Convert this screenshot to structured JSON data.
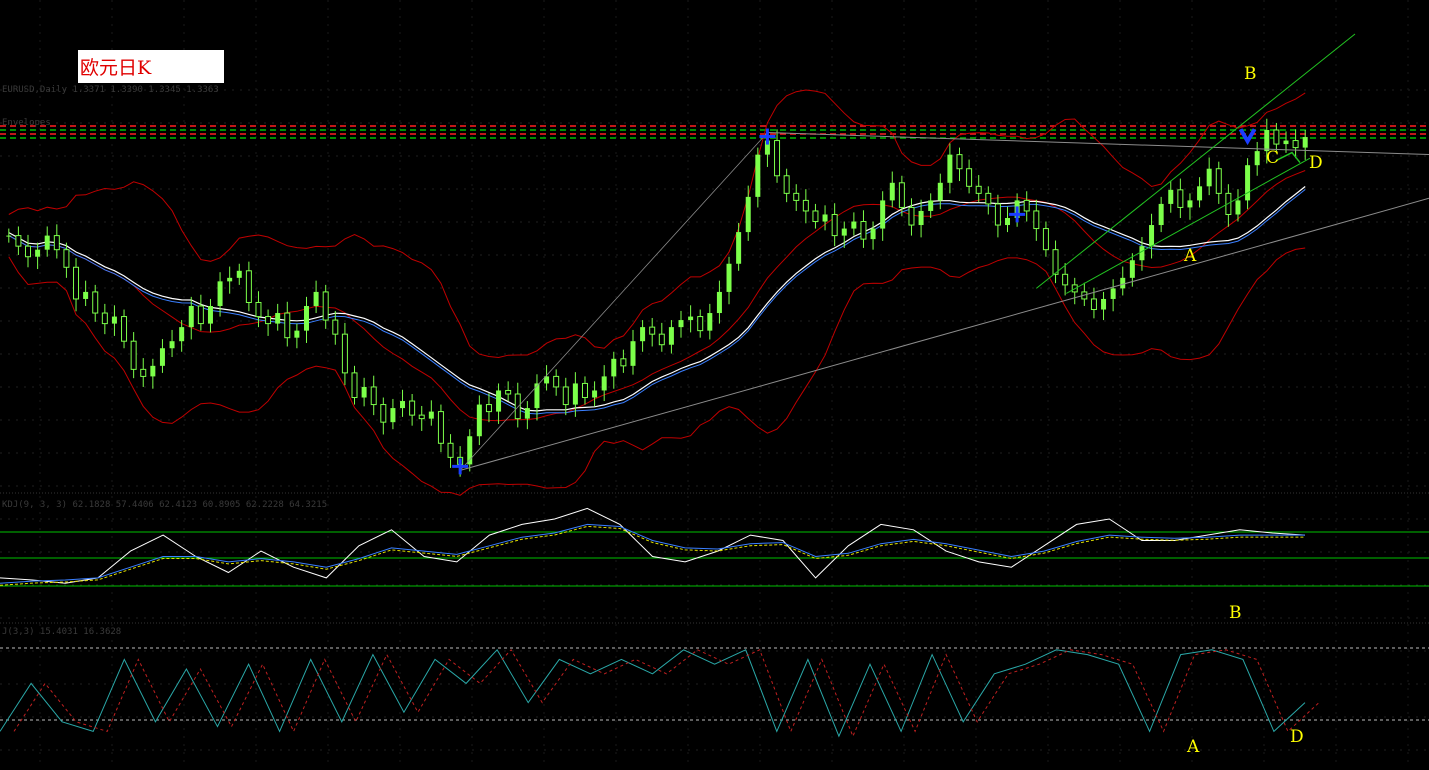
{
  "title": "欧元日K",
  "indicator_headers": {
    "main_a": "EURUSD,Daily 1.3371 1.3390 1.3345 1.3363",
    "main_b": "Envelopes",
    "stoch": "KDJ(9, 3, 3) 62.1828 57.4406 62.4123 60.8905 62.2228 64.3215",
    "cci": "J(3,3) 15.4031 16.3628"
  },
  "colors": {
    "background": "#000000",
    "bull_candle": "#7cff4a",
    "bear_candle": "#7cff4a",
    "bands": "#c00000",
    "ma_white": "#ffffff",
    "ma_blue": "#3a7fff",
    "trend_gray": "#8c8c8c",
    "channel_green": "#22c322",
    "level_red": "#ff2020",
    "level_green": "#00c000",
    "pivot_marker": "#1a3dff",
    "point_label": "#ffff00"
  },
  "chart_data": [
    {
      "type": "candlestick",
      "name": "main",
      "title": "欧元日K",
      "closes": [
        0.7,
        0.67,
        0.64,
        0.66,
        0.7,
        0.66,
        0.61,
        0.52,
        0.54,
        0.48,
        0.45,
        0.47,
        0.4,
        0.32,
        0.3,
        0.33,
        0.38,
        0.4,
        0.44,
        0.5,
        0.45,
        0.5,
        0.57,
        0.58,
        0.6,
        0.51,
        0.47,
        0.45,
        0.48,
        0.41,
        0.43,
        0.5,
        0.54,
        0.46,
        0.42,
        0.31,
        0.24,
        0.27,
        0.22,
        0.17,
        0.21,
        0.23,
        0.19,
        0.18,
        0.2,
        0.11,
        0.07,
        0.05,
        0.13,
        0.22,
        0.2,
        0.26,
        0.25,
        0.18,
        0.21,
        0.28,
        0.3,
        0.27,
        0.22,
        0.28,
        0.24,
        0.26,
        0.3,
        0.35,
        0.33,
        0.4,
        0.44,
        0.42,
        0.39,
        0.44,
        0.46,
        0.47,
        0.43,
        0.48,
        0.54,
        0.62,
        0.71,
        0.81,
        0.93,
        0.97,
        0.87,
        0.82,
        0.8,
        0.77,
        0.74,
        0.76,
        0.7,
        0.72,
        0.74,
        0.69,
        0.72,
        0.8,
        0.85,
        0.78,
        0.73,
        0.77,
        0.8,
        0.85,
        0.93,
        0.89,
        0.84,
        0.82,
        0.79,
        0.73,
        0.75,
        0.8,
        0.77,
        0.72,
        0.66,
        0.59,
        0.56,
        0.54,
        0.52,
        0.49,
        0.52,
        0.55,
        0.58,
        0.63,
        0.67,
        0.73,
        0.79,
        0.83,
        0.78,
        0.8,
        0.84,
        0.89,
        0.82,
        0.76,
        0.8,
        0.9,
        0.94,
        1.0,
        0.96,
        0.97,
        0.95,
        0.98
      ],
      "support_line": {
        "from": "pivot_low_1",
        "to": "right_edge"
      },
      "resistance_line": {
        "from": "pivot_high_1",
        "to": "right_edge"
      },
      "channel": {
        "color": "green"
      },
      "point_labels": [
        "B",
        "A",
        "C",
        "D"
      ]
    },
    {
      "type": "line",
      "name": "KDJ",
      "series": [
        {
          "values": [
            0.3,
            0.28,
            0.25,
            0.3,
            0.55,
            0.7,
            0.5,
            0.35,
            0.55,
            0.4,
            0.3,
            0.6,
            0.75,
            0.5,
            0.45,
            0.7,
            0.8,
            0.85,
            0.95,
            0.8,
            0.5,
            0.45,
            0.55,
            0.7,
            0.65,
            0.3,
            0.6,
            0.8,
            0.75,
            0.55,
            0.45,
            0.4,
            0.6,
            0.8,
            0.85,
            0.65,
            0.65,
            0.7,
            0.75,
            0.72,
            0.7
          ]
        },
        {
          "values": [
            0.25,
            0.27,
            0.28,
            0.3,
            0.4,
            0.5,
            0.5,
            0.45,
            0.48,
            0.45,
            0.4,
            0.48,
            0.58,
            0.55,
            0.52,
            0.6,
            0.68,
            0.72,
            0.8,
            0.78,
            0.65,
            0.58,
            0.57,
            0.62,
            0.63,
            0.5,
            0.53,
            0.62,
            0.66,
            0.62,
            0.56,
            0.5,
            0.55,
            0.64,
            0.7,
            0.68,
            0.67,
            0.68,
            0.7,
            0.7,
            0.7
          ]
        }
      ]
    },
    {
      "type": "line",
      "name": "J",
      "series": [
        {
          "values": [
            0.1,
            0.6,
            0.2,
            0.1,
            0.85,
            0.2,
            0.75,
            0.15,
            0.8,
            0.1,
            0.85,
            0.2,
            0.9,
            0.3,
            0.85,
            0.6,
            0.95,
            0.4,
            0.85,
            0.7,
            0.85,
            0.7,
            0.95,
            0.8,
            0.95,
            0.1,
            0.85,
            0.05,
            0.8,
            0.1,
            0.9,
            0.2,
            0.7,
            0.8,
            0.95,
            0.9,
            0.8,
            0.1,
            0.9,
            0.95,
            0.85,
            0.1,
            0.4
          ]
        }
      ]
    }
  ]
}
